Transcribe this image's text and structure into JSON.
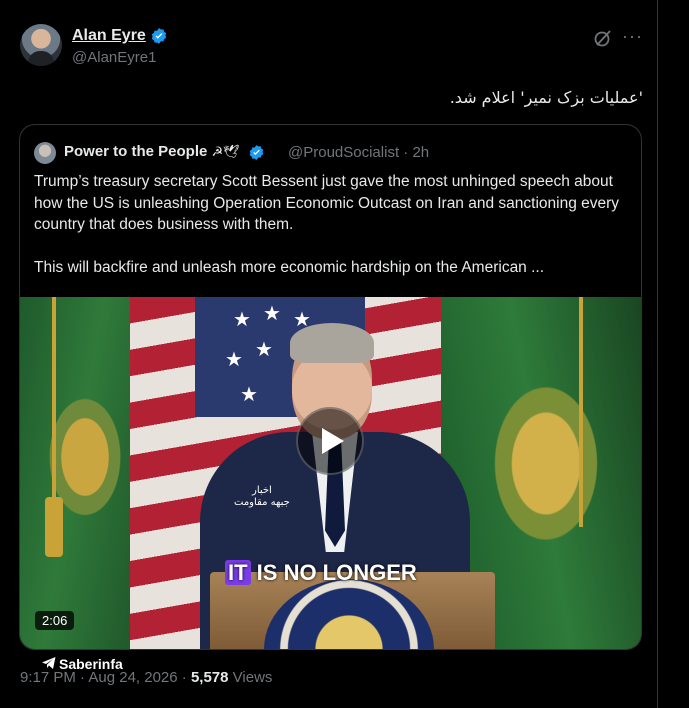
{
  "author": {
    "name": "Alan Eyre",
    "handle": "@AlanEyre1"
  },
  "tweet": {
    "text": "'عملیات بزک نمیر' اعلام شد."
  },
  "quoted": {
    "name": "Power to the People",
    "emoji": "☭🕊",
    "handle": "@ProudSocialist",
    "time": "· 2h",
    "paragraph1": "Trump’s treasury secretary Scott Bessent just gave the most unhinged speech about how the US is unleashing Operation Economic Outcast on Iran and sanctioning every country that does business with them.",
    "paragraph2": "This will backfire and unleash more economic hardship on the American ..."
  },
  "video": {
    "caption_highlight": "IT",
    "caption_rest": " IS NO LONGER",
    "duration": "2:06",
    "watermark_line1": "اخبار",
    "watermark_line2": "جبهه مقاومت"
  },
  "footer": {
    "timestamp": "9:17 PM · Aug 24, 2026 ·",
    "views_count": "5,578",
    "views_label": "Views"
  },
  "overlay": {
    "brand": "Saberinfa"
  },
  "colors": {
    "verified": "#1d9bf0",
    "muted": "#71767b",
    "border": "#2f3336",
    "caption_highlight": "#7b3ce6"
  },
  "icons": [
    "verified-icon",
    "grok-icon",
    "more-icon",
    "play-icon",
    "telegram-icon"
  ]
}
